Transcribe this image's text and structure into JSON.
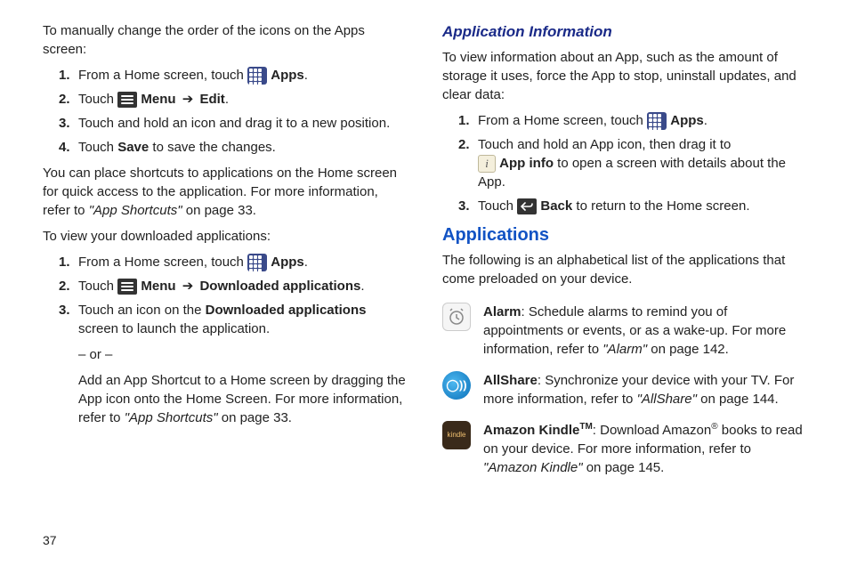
{
  "left": {
    "intro1": "To manually change the order of the icons on the Apps screen:",
    "steps1": [
      {
        "num": "1.",
        "pre": "From a Home screen, touch ",
        "bold": "Apps",
        "post": "."
      },
      {
        "num": "2.",
        "pre": "Touch ",
        "bold1": "Menu",
        "arrow": "➔",
        "bold2": "Edit",
        "post": "."
      },
      {
        "num": "3.",
        "text": "Touch and hold an icon and drag it to a new position."
      },
      {
        "num": "4.",
        "pre": "Touch ",
        "bold": "Save",
        "post": " to save the changes."
      }
    ],
    "para2a": "You can place shortcuts to applications on the Home screen for quick access to the application. For more information, refer to ",
    "para2ref": "\"App Shortcuts\"",
    "para2b": "  on page 33.",
    "intro2": "To view your downloaded applications:",
    "steps2": [
      {
        "num": "1.",
        "pre": "From a Home screen, touch ",
        "bold": "Apps",
        "post": "."
      },
      {
        "num": "2.",
        "pre": "Touch ",
        "bold1": "Menu",
        "arrow": "➔",
        "bold2": "Downloaded applications",
        "post": "."
      },
      {
        "num": "3.",
        "pre": "Touch an icon on the ",
        "bold": "Downloaded applications",
        "post": " screen to launch the application."
      }
    ],
    "or": "– or –",
    "sub2a": "Add an App Shortcut to a Home screen by dragging the App icon onto the Home Screen. For more information, refer to ",
    "sub2ref": "\"App Shortcuts\"",
    "sub2b": "  on page 33."
  },
  "right": {
    "h1": "Application Information",
    "intro": "To view information about an App, such as the amount of storage it uses, force the App to stop, uninstall updates, and clear data:",
    "steps": [
      {
        "num": "1.",
        "pre": "From a Home screen, touch ",
        "bold": "Apps",
        "post": "."
      },
      {
        "num": "2.",
        "line1": "Touch and hold an App icon, then drag it to",
        "bold": "App info",
        "line2": " to open a screen with details about the App."
      },
      {
        "num": "3.",
        "pre": "Touch ",
        "bold": "Back",
        "post": " to return to the Home screen."
      }
    ],
    "h2": "Applications",
    "intro2": "The following is an alphabetical list of the applications that come preloaded on your device.",
    "apps": [
      {
        "name": "Alarm",
        "desc": ": Schedule alarms to remind you of appointments or events, or as a wake-up. For more information, refer to ",
        "ref": "\"Alarm\"",
        "page": "  on page 142."
      },
      {
        "name": "AllShare",
        "desc": ": Synchronize your device with your TV. For more information, refer to ",
        "ref": "\"AllShare\"",
        "page": "  on page 144."
      },
      {
        "name": "Amazon Kindle",
        "tm": "TM",
        "desc1": ": Download Amazon",
        "reg": "®",
        "desc2": " books to read on your device. For more information, refer to ",
        "ref": "\"Amazon Kindle\"",
        "page": "  on page 145."
      }
    ]
  },
  "pagenum": "37"
}
